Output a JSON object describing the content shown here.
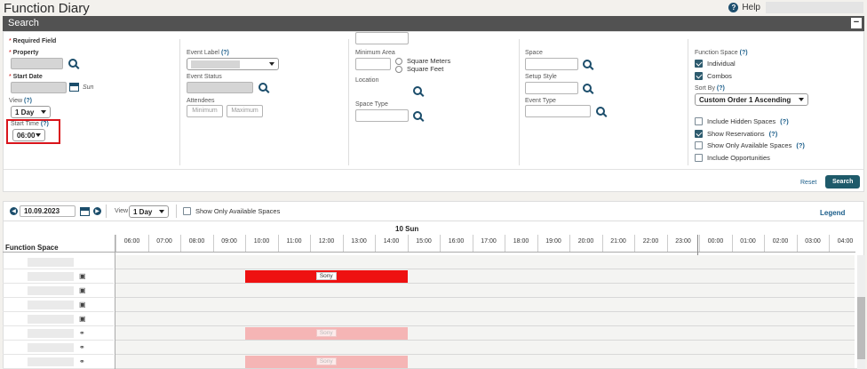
{
  "header": {
    "title": "Function Diary",
    "help_label": "Help"
  },
  "search": {
    "bar_title": "Search",
    "required_field": "Required Field",
    "property_label": "Property",
    "start_date_label": "Start Date",
    "start_date_day": "Sun",
    "view_label": "View",
    "view_value": "1 Day",
    "start_time_label": "Start Time",
    "start_time_value": "06:00",
    "help_mark": "(?)",
    "event_label_label": "Event Label",
    "event_status_label": "Event Status",
    "attendees_label": "Attendees",
    "attendees_min_placeholder": "Minimum",
    "attendees_max_placeholder": "Maximum",
    "minimum_area_label": "Minimum Area",
    "square_meters": "Square Meters",
    "square_feet": "Square Feet",
    "location_label": "Location",
    "space_type_label": "Space Type",
    "space_label": "Space",
    "setup_style_label": "Setup Style",
    "event_type_label": "Event Type",
    "function_space_label": "Function Space",
    "individual_label": "Individual",
    "combos_label": "Combos",
    "sort_by_label": "Sort By",
    "sort_by_value": "Custom Order 1 Ascending",
    "include_hidden_label": "Include Hidden Spaces",
    "show_reservations_label": "Show Reservations",
    "show_only_available_label": "Show Only Available Spaces",
    "include_opportunities_label": "Include Opportunities",
    "reset_label": "Reset",
    "search_button": "Search"
  },
  "diary": {
    "date_value": "10.09.2023",
    "view_label": "View",
    "view_value": "1 Day",
    "show_only_available_label": "Show Only Available Spaces",
    "legend_label": "Legend",
    "day_header": "10 Sun",
    "function_space_col": "Function Space",
    "hours": [
      "06:00",
      "07:00",
      "08:00",
      "09:00",
      "10:00",
      "11:00",
      "12:00",
      "13:00",
      "14:00",
      "15:00",
      "16:00",
      "17:00",
      "18:00",
      "19:00",
      "20:00",
      "21:00",
      "22:00",
      "23:00",
      "00:00",
      "01:00",
      "02:00",
      "03:00",
      "04:00"
    ],
    "events": [
      {
        "label": "Sony",
        "row": 1,
        "status": "reserved",
        "color": "#ee1111"
      },
      {
        "label": "Sony",
        "row": 5,
        "status": "tentative",
        "color": "#f5b5b5"
      },
      {
        "label": "Sony",
        "row": 7,
        "status": "tentative",
        "color": "#f5b5b5"
      }
    ]
  }
}
